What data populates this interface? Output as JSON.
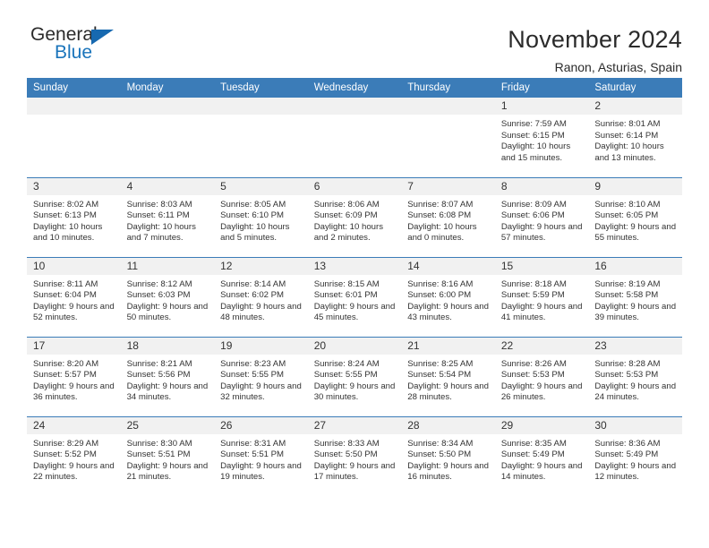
{
  "brand": {
    "name_part1": "General",
    "name_part2": "Blue",
    "colors": {
      "dark": "#2b2b2b",
      "blue": "#1a74bb"
    }
  },
  "header": {
    "title": "November 2024",
    "subtitle": "Ranon, Asturias, Spain"
  },
  "theme": {
    "header_row_bg": "#3b7cb8",
    "daynum_bg": "#f1f1f1",
    "text": "#333333",
    "border": "#3b7cb8"
  },
  "columns": [
    "Sunday",
    "Monday",
    "Tuesday",
    "Wednesday",
    "Thursday",
    "Friday",
    "Saturday"
  ],
  "labels": {
    "sunrise_prefix": "Sunrise:",
    "sunset_prefix": "Sunset:",
    "daylight_prefix": "Daylight:"
  },
  "weeks": [
    [
      {
        "day": "",
        "blank": true
      },
      {
        "day": "",
        "blank": true
      },
      {
        "day": "",
        "blank": true
      },
      {
        "day": "",
        "blank": true
      },
      {
        "day": "",
        "blank": true
      },
      {
        "day": "1",
        "sunrise": "Sunrise: 7:59 AM",
        "sunset": "Sunset: 6:15 PM",
        "daylight": "Daylight: 10 hours and 15 minutes."
      },
      {
        "day": "2",
        "sunrise": "Sunrise: 8:01 AM",
        "sunset": "Sunset: 6:14 PM",
        "daylight": "Daylight: 10 hours and 13 minutes."
      }
    ],
    [
      {
        "day": "3",
        "sunrise": "Sunrise: 8:02 AM",
        "sunset": "Sunset: 6:13 PM",
        "daylight": "Daylight: 10 hours and 10 minutes."
      },
      {
        "day": "4",
        "sunrise": "Sunrise: 8:03 AM",
        "sunset": "Sunset: 6:11 PM",
        "daylight": "Daylight: 10 hours and 7 minutes."
      },
      {
        "day": "5",
        "sunrise": "Sunrise: 8:05 AM",
        "sunset": "Sunset: 6:10 PM",
        "daylight": "Daylight: 10 hours and 5 minutes."
      },
      {
        "day": "6",
        "sunrise": "Sunrise: 8:06 AM",
        "sunset": "Sunset: 6:09 PM",
        "daylight": "Daylight: 10 hours and 2 minutes."
      },
      {
        "day": "7",
        "sunrise": "Sunrise: 8:07 AM",
        "sunset": "Sunset: 6:08 PM",
        "daylight": "Daylight: 10 hours and 0 minutes."
      },
      {
        "day": "8",
        "sunrise": "Sunrise: 8:09 AM",
        "sunset": "Sunset: 6:06 PM",
        "daylight": "Daylight: 9 hours and 57 minutes."
      },
      {
        "day": "9",
        "sunrise": "Sunrise: 8:10 AM",
        "sunset": "Sunset: 6:05 PM",
        "daylight": "Daylight: 9 hours and 55 minutes."
      }
    ],
    [
      {
        "day": "10",
        "sunrise": "Sunrise: 8:11 AM",
        "sunset": "Sunset: 6:04 PM",
        "daylight": "Daylight: 9 hours and 52 minutes."
      },
      {
        "day": "11",
        "sunrise": "Sunrise: 8:12 AM",
        "sunset": "Sunset: 6:03 PM",
        "daylight": "Daylight: 9 hours and 50 minutes."
      },
      {
        "day": "12",
        "sunrise": "Sunrise: 8:14 AM",
        "sunset": "Sunset: 6:02 PM",
        "daylight": "Daylight: 9 hours and 48 minutes."
      },
      {
        "day": "13",
        "sunrise": "Sunrise: 8:15 AM",
        "sunset": "Sunset: 6:01 PM",
        "daylight": "Daylight: 9 hours and 45 minutes."
      },
      {
        "day": "14",
        "sunrise": "Sunrise: 8:16 AM",
        "sunset": "Sunset: 6:00 PM",
        "daylight": "Daylight: 9 hours and 43 minutes."
      },
      {
        "day": "15",
        "sunrise": "Sunrise: 8:18 AM",
        "sunset": "Sunset: 5:59 PM",
        "daylight": "Daylight: 9 hours and 41 minutes."
      },
      {
        "day": "16",
        "sunrise": "Sunrise: 8:19 AM",
        "sunset": "Sunset: 5:58 PM",
        "daylight": "Daylight: 9 hours and 39 minutes."
      }
    ],
    [
      {
        "day": "17",
        "sunrise": "Sunrise: 8:20 AM",
        "sunset": "Sunset: 5:57 PM",
        "daylight": "Daylight: 9 hours and 36 minutes."
      },
      {
        "day": "18",
        "sunrise": "Sunrise: 8:21 AM",
        "sunset": "Sunset: 5:56 PM",
        "daylight": "Daylight: 9 hours and 34 minutes."
      },
      {
        "day": "19",
        "sunrise": "Sunrise: 8:23 AM",
        "sunset": "Sunset: 5:55 PM",
        "daylight": "Daylight: 9 hours and 32 minutes."
      },
      {
        "day": "20",
        "sunrise": "Sunrise: 8:24 AM",
        "sunset": "Sunset: 5:55 PM",
        "daylight": "Daylight: 9 hours and 30 minutes."
      },
      {
        "day": "21",
        "sunrise": "Sunrise: 8:25 AM",
        "sunset": "Sunset: 5:54 PM",
        "daylight": "Daylight: 9 hours and 28 minutes."
      },
      {
        "day": "22",
        "sunrise": "Sunrise: 8:26 AM",
        "sunset": "Sunset: 5:53 PM",
        "daylight": "Daylight: 9 hours and 26 minutes."
      },
      {
        "day": "23",
        "sunrise": "Sunrise: 8:28 AM",
        "sunset": "Sunset: 5:53 PM",
        "daylight": "Daylight: 9 hours and 24 minutes."
      }
    ],
    [
      {
        "day": "24",
        "sunrise": "Sunrise: 8:29 AM",
        "sunset": "Sunset: 5:52 PM",
        "daylight": "Daylight: 9 hours and 22 minutes."
      },
      {
        "day": "25",
        "sunrise": "Sunrise: 8:30 AM",
        "sunset": "Sunset: 5:51 PM",
        "daylight": "Daylight: 9 hours and 21 minutes."
      },
      {
        "day": "26",
        "sunrise": "Sunrise: 8:31 AM",
        "sunset": "Sunset: 5:51 PM",
        "daylight": "Daylight: 9 hours and 19 minutes."
      },
      {
        "day": "27",
        "sunrise": "Sunrise: 8:33 AM",
        "sunset": "Sunset: 5:50 PM",
        "daylight": "Daylight: 9 hours and 17 minutes."
      },
      {
        "day": "28",
        "sunrise": "Sunrise: 8:34 AM",
        "sunset": "Sunset: 5:50 PM",
        "daylight": "Daylight: 9 hours and 16 minutes."
      },
      {
        "day": "29",
        "sunrise": "Sunrise: 8:35 AM",
        "sunset": "Sunset: 5:49 PM",
        "daylight": "Daylight: 9 hours and 14 minutes."
      },
      {
        "day": "30",
        "sunrise": "Sunrise: 8:36 AM",
        "sunset": "Sunset: 5:49 PM",
        "daylight": "Daylight: 9 hours and 12 minutes."
      }
    ]
  ]
}
